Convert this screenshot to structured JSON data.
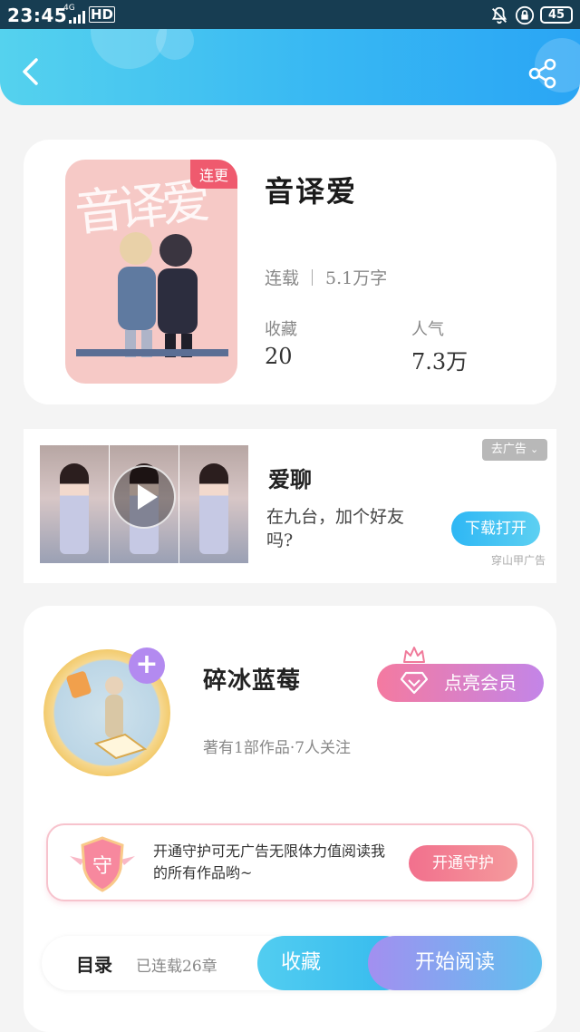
{
  "status_bar": {
    "time": "23:45",
    "network": "4G",
    "hd": "HD",
    "battery": "45"
  },
  "book": {
    "cover_title": "音译爱",
    "badge": "连更",
    "title": "音译爱",
    "status": "连载",
    "word_count": "5.1万字",
    "favorites_label": "收藏",
    "favorites_value": "20",
    "popularity_label": "人气",
    "popularity_value": "7.3万"
  },
  "ad": {
    "remove_label": "去广告",
    "title": "爱聊",
    "description": "在九台，加个好友吗?",
    "download_label": "下载打开",
    "source": "穿山甲广告"
  },
  "author": {
    "name": "碎冰蓝莓",
    "info": "著有1部作品·7人关注",
    "vip_label": "点亮会员",
    "guard_badge": "守",
    "guard_text": "开通守护可无广告无限体力值阅读我的所有作品哟~",
    "guard_button": "开通守护"
  },
  "bottom_bar": {
    "toc_label": "目录",
    "toc_count": "已连载26章",
    "favorite_button": "收藏",
    "read_button": "开始阅读"
  },
  "colors": {
    "header_gradient": [
      "#55d2ee",
      "#2aa5f4"
    ],
    "cover_badge": "#ef5a6e",
    "vip_gradient": [
      "#f47aa0",
      "#c385e8"
    ],
    "guard_button": "#f2708d"
  },
  "icons": [
    "back-arrow-icon",
    "share-icon",
    "bell-off-icon",
    "lock-icon",
    "play-icon",
    "chevron-down-icon",
    "crown-icon",
    "diamond-icon",
    "guard-shield-icon",
    "plus-icon"
  ]
}
